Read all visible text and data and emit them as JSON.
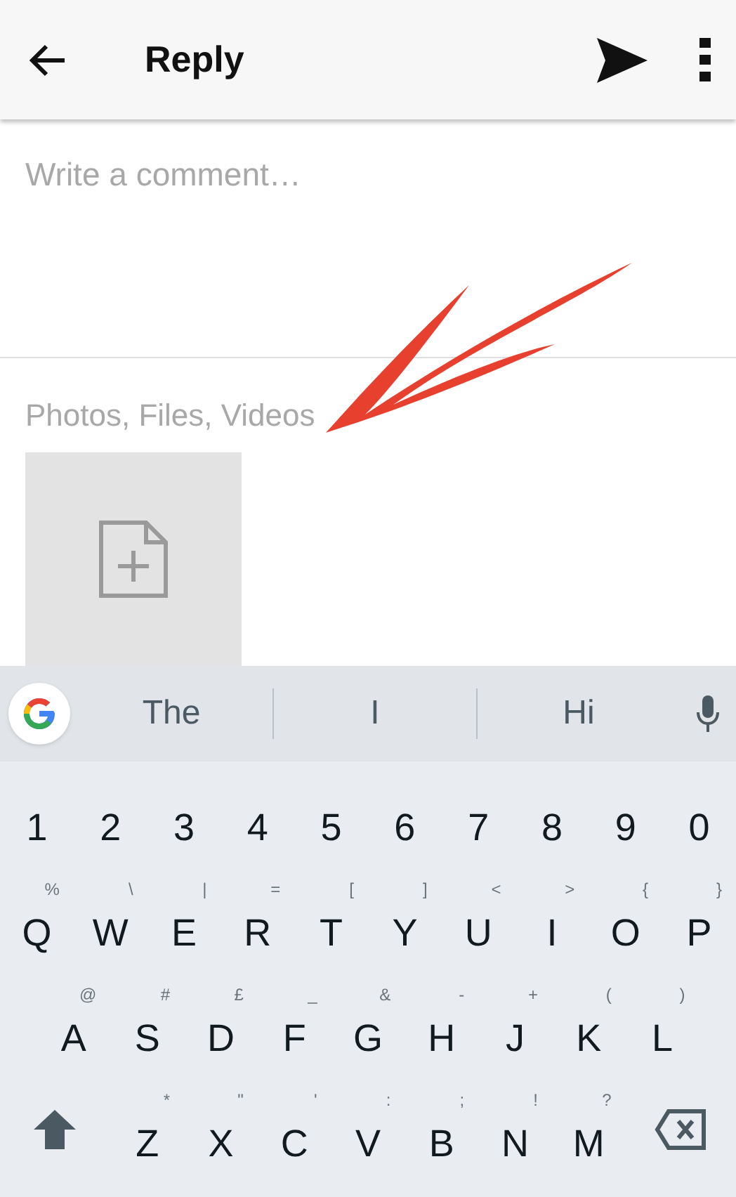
{
  "app_bar": {
    "title": "Reply"
  },
  "comment": {
    "placeholder": "Write a comment…"
  },
  "attachments": {
    "label": "Photos, Files, Videos"
  },
  "annotation": {
    "kind": "arrow",
    "color": "#e8402f"
  },
  "suggestions": [
    "The",
    "I",
    "Hi"
  ],
  "keyboard": {
    "rows": [
      {
        "keys": [
          {
            "kind": "char",
            "label": "1"
          },
          {
            "kind": "char",
            "label": "2"
          },
          {
            "kind": "char",
            "label": "3"
          },
          {
            "kind": "char",
            "label": "4"
          },
          {
            "kind": "char",
            "label": "5"
          },
          {
            "kind": "char",
            "label": "6"
          },
          {
            "kind": "char",
            "label": "7"
          },
          {
            "kind": "char",
            "label": "8"
          },
          {
            "kind": "char",
            "label": "9"
          },
          {
            "kind": "char",
            "label": "0"
          }
        ]
      },
      {
        "keys": [
          {
            "kind": "char",
            "label": "Q",
            "hint": "%"
          },
          {
            "kind": "char",
            "label": "W",
            "hint": "\\"
          },
          {
            "kind": "char",
            "label": "E",
            "hint": "|"
          },
          {
            "kind": "char",
            "label": "R",
            "hint": "="
          },
          {
            "kind": "char",
            "label": "T",
            "hint": "["
          },
          {
            "kind": "char",
            "label": "Y",
            "hint": "]"
          },
          {
            "kind": "char",
            "label": "U",
            "hint": "<"
          },
          {
            "kind": "char",
            "label": "I",
            "hint": ">"
          },
          {
            "kind": "char",
            "label": "O",
            "hint": "{"
          },
          {
            "kind": "char",
            "label": "P",
            "hint": "}"
          }
        ]
      },
      {
        "keys": [
          {
            "kind": "char",
            "label": "A",
            "hint": "@"
          },
          {
            "kind": "char",
            "label": "S",
            "hint": "#"
          },
          {
            "kind": "char",
            "label": "D",
            "hint": "£"
          },
          {
            "kind": "char",
            "label": "F",
            "hint": "_"
          },
          {
            "kind": "char",
            "label": "G",
            "hint": "&"
          },
          {
            "kind": "char",
            "label": "H",
            "hint": "-"
          },
          {
            "kind": "char",
            "label": "J",
            "hint": "+"
          },
          {
            "kind": "char",
            "label": "K",
            "hint": "("
          },
          {
            "kind": "char",
            "label": "L",
            "hint": ")"
          }
        ]
      },
      {
        "keys": [
          {
            "kind": "shift"
          },
          {
            "kind": "char",
            "label": "Z",
            "hint": "*"
          },
          {
            "kind": "char",
            "label": "X",
            "hint": "\""
          },
          {
            "kind": "char",
            "label": "C",
            "hint": "'"
          },
          {
            "kind": "char",
            "label": "V",
            "hint": ":"
          },
          {
            "kind": "char",
            "label": "B",
            "hint": ";"
          },
          {
            "kind": "char",
            "label": "N",
            "hint": "!"
          },
          {
            "kind": "char",
            "label": "M",
            "hint": "?"
          },
          {
            "kind": "backspace"
          }
        ]
      }
    ]
  }
}
